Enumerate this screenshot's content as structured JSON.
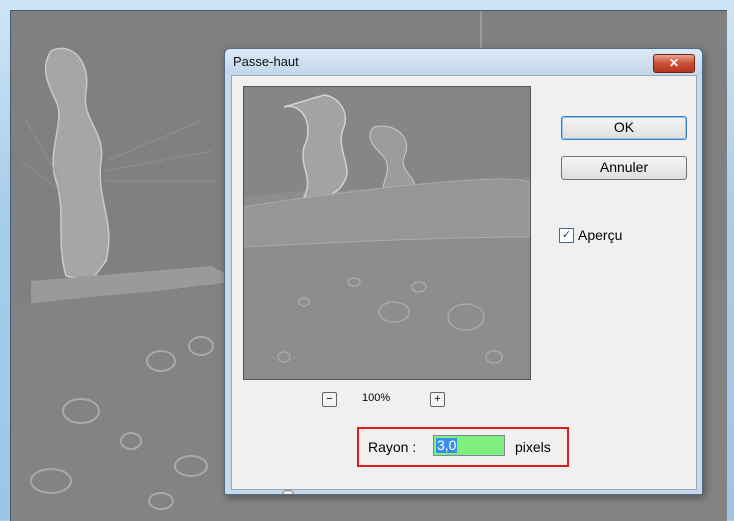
{
  "dialog": {
    "title": "Passe-haut",
    "close_label": "✕",
    "ok_label": "OK",
    "cancel_label": "Annuler",
    "preview_checkbox": {
      "label": "Aperçu",
      "checked": true,
      "check_glyph": "✓"
    },
    "zoom": {
      "minus": "−",
      "level": "100%",
      "plus": "+"
    },
    "radius": {
      "label": "Rayon :",
      "value": "3,0",
      "unit": "pixels"
    },
    "slider_level": 0.1
  },
  "colors": {
    "window_frame": "#a8cdea",
    "canvas_gray": "#7f7f7f",
    "dialog_body": "#f0f0f0",
    "close_red": "#c0392b",
    "radius_highlight": "#e01b1b",
    "radius_input": "#7ff07f",
    "selection_blue": "#3a8ee6"
  },
  "icons": {
    "close": "close-icon",
    "zoom_out": "minus-icon",
    "zoom_in": "plus-icon",
    "checkbox": "check-icon"
  }
}
